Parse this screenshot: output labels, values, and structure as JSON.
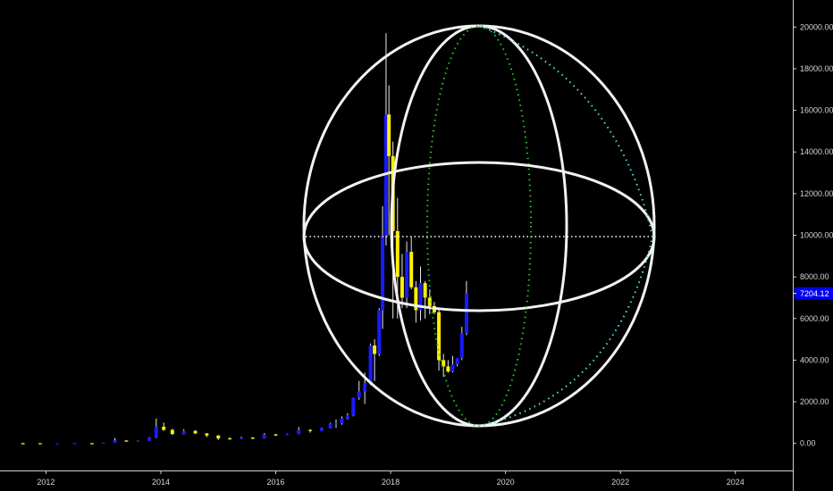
{
  "chart_data": {
    "type": "candlestick",
    "x_range": [
      2011.2,
      2025.0
    ],
    "y_range": [
      -1300,
      21300
    ],
    "x_ticks": [
      "2012",
      "2014",
      "2016",
      "2018",
      "2020",
      "2022",
      "2024"
    ],
    "y_ticks": [
      "0.00",
      "2000.00",
      "4000.00",
      "6000.00",
      "8000.00",
      "10000.00",
      "12000.00",
      "14000.00",
      "16000.00",
      "18000.00",
      "20000.00"
    ],
    "last_price_label": "7204.12",
    "last_price": 7204.12,
    "colors": {
      "up": "#1a1aff",
      "down": "#ffee00",
      "sphere": "#ffffff",
      "green_dots": "#22cc22",
      "cyan_dots": "#55dddd",
      "price_badge": "#0000ee"
    },
    "candles": [
      {
        "t": 2011.6,
        "o": 10,
        "h": 30,
        "l": 2,
        "c": 8
      },
      {
        "t": 2011.9,
        "o": 8,
        "h": 15,
        "l": 2,
        "c": 4
      },
      {
        "t": 2012.2,
        "o": 4,
        "h": 8,
        "l": 3,
        "c": 5
      },
      {
        "t": 2012.5,
        "o": 5,
        "h": 15,
        "l": 4,
        "c": 12
      },
      {
        "t": 2012.8,
        "o": 12,
        "h": 14,
        "l": 8,
        "c": 10
      },
      {
        "t": 2013.0,
        "o": 10,
        "h": 35,
        "l": 9,
        "c": 30
      },
      {
        "t": 2013.2,
        "o": 30,
        "h": 260,
        "l": 28,
        "c": 140
      },
      {
        "t": 2013.4,
        "o": 140,
        "h": 150,
        "l": 70,
        "c": 110
      },
      {
        "t": 2013.6,
        "o": 110,
        "h": 140,
        "l": 90,
        "c": 130
      },
      {
        "t": 2013.8,
        "o": 130,
        "h": 300,
        "l": 120,
        "c": 280
      },
      {
        "t": 2013.92,
        "o": 280,
        "h": 1200,
        "l": 250,
        "c": 800
      },
      {
        "t": 2014.05,
        "o": 800,
        "h": 1000,
        "l": 600,
        "c": 650
      },
      {
        "t": 2014.2,
        "o": 650,
        "h": 700,
        "l": 400,
        "c": 450
      },
      {
        "t": 2014.4,
        "o": 450,
        "h": 680,
        "l": 430,
        "c": 600
      },
      {
        "t": 2014.6,
        "o": 600,
        "h": 640,
        "l": 450,
        "c": 480
      },
      {
        "t": 2014.8,
        "o": 480,
        "h": 500,
        "l": 300,
        "c": 380
      },
      {
        "t": 2015.0,
        "o": 380,
        "h": 400,
        "l": 160,
        "c": 240
      },
      {
        "t": 2015.2,
        "o": 240,
        "h": 300,
        "l": 200,
        "c": 230
      },
      {
        "t": 2015.4,
        "o": 230,
        "h": 320,
        "l": 210,
        "c": 280
      },
      {
        "t": 2015.6,
        "o": 280,
        "h": 300,
        "l": 200,
        "c": 240
      },
      {
        "t": 2015.8,
        "o": 240,
        "h": 500,
        "l": 230,
        "c": 430
      },
      {
        "t": 2016.0,
        "o": 430,
        "h": 460,
        "l": 360,
        "c": 420
      },
      {
        "t": 2016.2,
        "o": 420,
        "h": 470,
        "l": 400,
        "c": 450
      },
      {
        "t": 2016.4,
        "o": 450,
        "h": 780,
        "l": 440,
        "c": 650
      },
      {
        "t": 2016.6,
        "o": 650,
        "h": 680,
        "l": 520,
        "c": 600
      },
      {
        "t": 2016.8,
        "o": 600,
        "h": 760,
        "l": 590,
        "c": 730
      },
      {
        "t": 2016.95,
        "o": 730,
        "h": 1000,
        "l": 720,
        "c": 960
      },
      {
        "t": 2017.05,
        "o": 960,
        "h": 1150,
        "l": 750,
        "c": 970
      },
      {
        "t": 2017.15,
        "o": 970,
        "h": 1300,
        "l": 900,
        "c": 1200
      },
      {
        "t": 2017.25,
        "o": 1200,
        "h": 1450,
        "l": 1150,
        "c": 1350
      },
      {
        "t": 2017.35,
        "o": 1350,
        "h": 2200,
        "l": 1300,
        "c": 2200
      },
      {
        "t": 2017.45,
        "o": 2200,
        "h": 3000,
        "l": 2100,
        "c": 2500
      },
      {
        "t": 2017.55,
        "o": 2500,
        "h": 3400,
        "l": 1900,
        "c": 2900
      },
      {
        "t": 2017.65,
        "o": 2900,
        "h": 4800,
        "l": 2800,
        "c": 4700
      },
      {
        "t": 2017.72,
        "o": 4700,
        "h": 5000,
        "l": 3000,
        "c": 4300
      },
      {
        "t": 2017.8,
        "o": 4300,
        "h": 6500,
        "l": 4200,
        "c": 6400
      },
      {
        "t": 2017.86,
        "o": 6400,
        "h": 11400,
        "l": 5500,
        "c": 10000
      },
      {
        "t": 2017.92,
        "o": 10000,
        "h": 19700,
        "l": 9500,
        "c": 15800
      },
      {
        "t": 2017.97,
        "o": 15800,
        "h": 17200,
        "l": 10000,
        "c": 13800
      },
      {
        "t": 2018.04,
        "o": 13800,
        "h": 14500,
        "l": 6000,
        "c": 10200
      },
      {
        "t": 2018.12,
        "o": 10200,
        "h": 11800,
        "l": 6000,
        "c": 8000
      },
      {
        "t": 2018.2,
        "o": 8000,
        "h": 9100,
        "l": 6500,
        "c": 7000
      },
      {
        "t": 2018.28,
        "o": 7000,
        "h": 9700,
        "l": 6500,
        "c": 9200
      },
      {
        "t": 2018.36,
        "o": 9200,
        "h": 9900,
        "l": 7400,
        "c": 7500
      },
      {
        "t": 2018.44,
        "o": 7500,
        "h": 7800,
        "l": 5800,
        "c": 6400
      },
      {
        "t": 2018.52,
        "o": 6400,
        "h": 8500,
        "l": 5900,
        "c": 7700
      },
      {
        "t": 2018.6,
        "o": 7700,
        "h": 7800,
        "l": 6000,
        "c": 7000
      },
      {
        "t": 2018.68,
        "o": 7000,
        "h": 7400,
        "l": 6200,
        "c": 6600
      },
      {
        "t": 2018.76,
        "o": 6600,
        "h": 6800,
        "l": 6200,
        "c": 6300
      },
      {
        "t": 2018.84,
        "o": 6300,
        "h": 6500,
        "l": 3500,
        "c": 4000
      },
      {
        "t": 2018.92,
        "o": 4000,
        "h": 4300,
        "l": 3200,
        "c": 3700
      },
      {
        "t": 2019.0,
        "o": 3700,
        "h": 4000,
        "l": 3400,
        "c": 3450
      },
      {
        "t": 2019.08,
        "o": 3450,
        "h": 4200,
        "l": 3400,
        "c": 3800
      },
      {
        "t": 2019.16,
        "o": 3800,
        "h": 4100,
        "l": 3700,
        "c": 4100
      },
      {
        "t": 2019.24,
        "o": 4100,
        "h": 5600,
        "l": 4000,
        "c": 5300
      },
      {
        "t": 2019.32,
        "o": 5300,
        "h": 7800,
        "l": 5200,
        "c": 7204
      }
    ]
  }
}
